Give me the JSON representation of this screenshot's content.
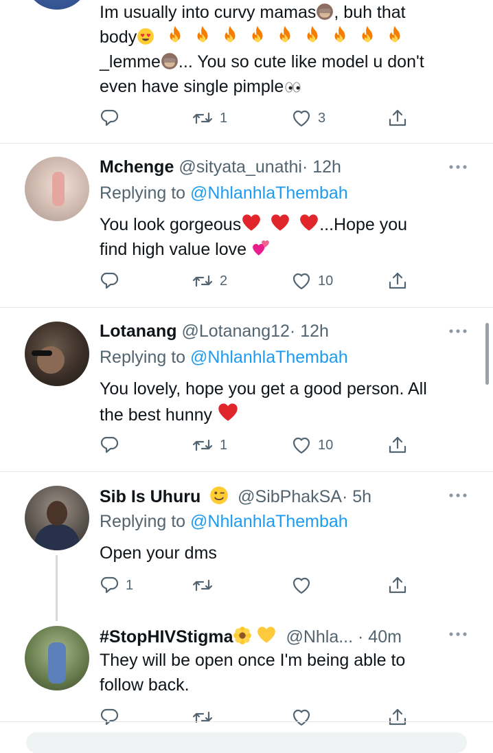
{
  "tweets": [
    {
      "text_lines": [
        "Im usually into curvy mamas",
        ", buh that",
        "body",
        "_lemme",
        "... You so cute like model u don't",
        "even have single pimple"
      ],
      "stats": {
        "replies": "",
        "retweets": "1",
        "likes": "3"
      }
    },
    {
      "name": "Mchenge",
      "handle": "@sityata_unathi",
      "time": "· 12h",
      "replying_prefix": "Replying to",
      "replying_to": "@NhlanhlaThembah",
      "text_lines": [
        "You look gorgeous",
        "...Hope  you",
        "find high value love"
      ],
      "stats": {
        "replies": "",
        "retweets": "2",
        "likes": "10"
      }
    },
    {
      "name": "Lotanang",
      "handle": "@Lotanang12",
      "time": "· 12h",
      "replying_prefix": "Replying to",
      "replying_to": "@NhlanhlaThembah",
      "text_lines": [
        "You lovely, hope you get a good person. All",
        "the best hunny"
      ],
      "stats": {
        "replies": "",
        "retweets": "1",
        "likes": "10"
      }
    },
    {
      "name": "Sib Is Uhuru",
      "handle": "@SibPhakSA",
      "time": "· 5h",
      "replying_prefix": "Replying to",
      "replying_to": "@NhlanhlaThembah",
      "text_lines": [
        "Open your dms"
      ],
      "stats": {
        "replies": "1",
        "retweets": "",
        "likes": ""
      }
    },
    {
      "name": "#StopHIVStigma",
      "handle": "@Nhla...",
      "time": "· 40m",
      "text_lines": [
        "They will be open once I'm being able to",
        "follow back."
      ],
      "stats": {
        "replies": "",
        "retweets": "",
        "likes": ""
      }
    }
  ],
  "icons": {
    "reply": "reply-icon",
    "retweet": "retweet-icon",
    "like": "heart-icon",
    "share": "share-icon",
    "more": "more-options-icon"
  },
  "colors": {
    "text": "#0f1419",
    "secondary": "#536471",
    "link": "#1d9bf0",
    "divider": "#e6e6e6",
    "heart_emoji": "#e0252b"
  }
}
